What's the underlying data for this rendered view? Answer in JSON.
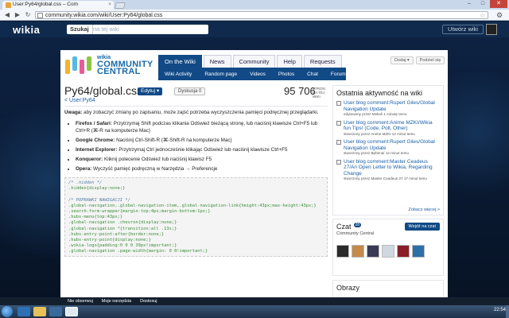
{
  "browser": {
    "tab_title": "User:Py64/global.css – Com",
    "tab_close": "×",
    "url": "community.wikia.com/wiki/User:Py64/global.css",
    "window_buttons": {
      "minimize": "–",
      "maximize": "□",
      "close": "✕"
    },
    "nav": {
      "back": "◀",
      "forward": "▶",
      "reload": "↻"
    }
  },
  "wikia_bar": {
    "logo": "wikia",
    "search_button": "Szukaj",
    "search_placeholder": "na tej wiki",
    "create_button": "Utwórz wiki"
  },
  "hub": {
    "name_small": "wikia",
    "name_line1": "COMMUNITY",
    "name_line2": "CENTRAL",
    "tabs": [
      "On the Wiki",
      "News",
      "Community",
      "Help",
      "Requests"
    ],
    "active_tab": "On the Wiki",
    "subnav": [
      "Wiki Activity",
      "Random page",
      "Videos",
      "Photos",
      "Chat",
      "Forum"
    ],
    "tools": [
      "Dodaj ▾",
      "Podziel się"
    ]
  },
  "article": {
    "title": "Py64/global.css",
    "edit_button": "Edytuj ▾",
    "talk_button": "Dyskusja 0",
    "page_count": "95 706",
    "page_count_label": "STRON NA TEJ WIKI",
    "back_link": "< User:Py64",
    "note_lead": "Uwaga:",
    "note_text": " aby zobaczyć zmiany po zapisaniu, może zajść potrzeba wyczyszczenia pamięci podręcznej przeglądarki.",
    "browsers": [
      {
        "name": "Firefox / Safari:",
        "text": " Przytrzymaj Shift podczas klikania Odśwież bieżącą stronę, lub naciśnij klawisze Ctrl+F5 lub Ctrl+R (⌘-R na komputerze Mac)"
      },
      {
        "name": "Google Chrome:",
        "text": " Naciśnij Ctrl-Shift-R (⌘-Shift-R na komputerze Mac)"
      },
      {
        "name": "Internet Explorer:",
        "text": " Przytrzymaj Ctrl jednocześnie klikając Odśwież lub naciśnij klawisze Ctrl+F5"
      },
      {
        "name": "Konqueror:",
        "text": " Kliknij polecenie Odśwież lub naciśnij klawisz F5"
      },
      {
        "name": "Opera:",
        "text": " Wyczyść pamięć podręczną w Narzędzia → Preferencje"
      }
    ],
    "code_lines": [
      {
        "cls": "c-com",
        "text": "/* .hidden */"
      },
      {
        "cls": "c-sel",
        "text": ".hidden{display:none;}"
      },
      {
        "cls": "c-sel",
        "text": ""
      },
      {
        "cls": "c-com",
        "text": "/* POPRAWKI NAWIGACJI */"
      },
      {
        "cls": "c-sel",
        "text": ".global-navigation,.global-navigation-item,.global-navigation-link{height:43px;max-height:43px;}"
      },
      {
        "cls": "c-sel",
        "text": ".search-form-wrapper{margin-top:4px;margin-bottom:1px;}"
      },
      {
        "cls": "c-sel",
        "text": ".hubs-menu{top:43px;}"
      },
      {
        "cls": "c-sel",
        "text": ".global-navigation .chevron{display:none;}"
      },
      {
        "cls": "c-sel",
        "text": ".global-navigation *{transition:all .13s;}"
      },
      {
        "cls": "c-sel",
        "text": ".hubs-entry-point:after{border:none;}"
      },
      {
        "cls": "c-sel",
        "text": ".hubs-entry-point{display:none;}"
      },
      {
        "cls": "c-sel",
        "text": ".wikia-logo{padding:0 0 0 39px!important;}"
      },
      {
        "cls": "c-sel",
        "text": ".global-navigation .page-width{margin: 0 0!important;}"
      }
    ]
  },
  "rail": {
    "activity_title": "Ostatnia aktywność na wiki",
    "activity": [
      {
        "title": "User blog comment:Rupert Giles/Global Navigation Update",
        "meta": "edytowany przez Mekoli 1 minutę temu"
      },
      {
        "title": "User blog comment:Anime MZKI/Wikia fun Tips! (Code, Poll, Other)",
        "meta": "stworzony przez Anime MZKI 12 minut temu"
      },
      {
        "title": "User blog comment:Rupert Giles/Global Navigation Update",
        "meta": "stworzony przez Bębenaí 12 minut temu"
      },
      {
        "title": "User blog comment:Master Ceadeus 27/An Open Letter to Wikia, Regarding Change",
        "meta": "stworzony przez Master Ceadeus 27 17 minut temu"
      }
    ],
    "activity_more": "Zobacz więcej >",
    "chat_title": "Czat",
    "chat_count": "28",
    "chat_button": "Wejdź na czat",
    "chat_sub": "Community Central",
    "images_title": "Obrazy"
  },
  "toolbar": {
    "unwatch": "Nie obserwuj",
    "my_tools": "Moje narzędzia",
    "customize": "Dostosuj"
  },
  "taskbar": {
    "clock": "22:54"
  },
  "colors": {
    "wikia_navy": "#0f2a4d",
    "hub_blue": "#114a86",
    "link_blue": "#1a5fa8"
  }
}
